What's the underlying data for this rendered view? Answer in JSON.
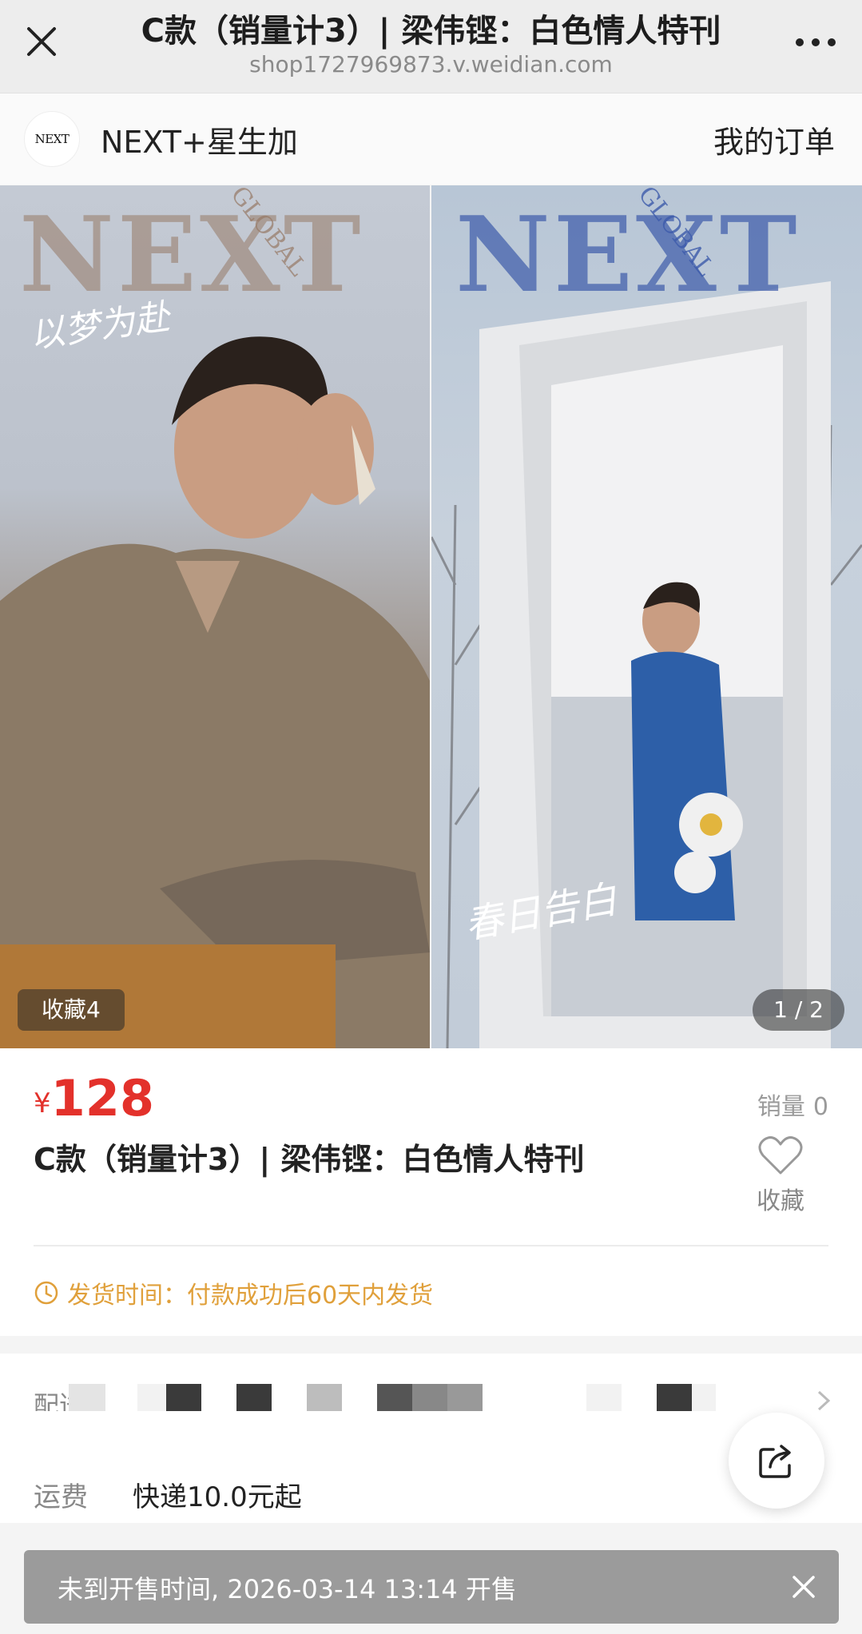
{
  "window": {
    "title": "C款（销量计3）| 梁伟铿：白色情人特刊",
    "url": "shop1727969873.v.weidian.com",
    "close_icon": "close-icon",
    "more_icon": "more-dots-icon"
  },
  "shop": {
    "logo_text": "NEXT",
    "name": "NEXT+星生加",
    "orders_link": "我的订单"
  },
  "gallery": {
    "left_image": {
      "magazine": "NEXT",
      "edition": "GLOBAL",
      "caption": "以梦为赴"
    },
    "right_image": {
      "magazine": "NEXT",
      "edition": "GLOBAL",
      "caption": "春日告白"
    },
    "favorites_badge": "收藏4",
    "page_indicator": "1 / 2"
  },
  "product": {
    "currency": "¥",
    "price": "128",
    "sales_label": "销量",
    "sales_count": "0",
    "title": "C款（销量计3）| 梁伟铿：白色情人特刊",
    "favorite_label": "收藏",
    "shipping_time": "发货时间：付款成功后60天内发货"
  },
  "delivery": {
    "label": "配送"
  },
  "shipping_fee": {
    "label": "运费",
    "value": "快递10.0元起"
  },
  "notice": {
    "text": "未到开售时间, 2026-03-14 13:14 开售"
  },
  "colors": {
    "price_red": "#e3312b",
    "ship_orange": "#e0a03b",
    "banner_gray": "#9b9b9b"
  }
}
